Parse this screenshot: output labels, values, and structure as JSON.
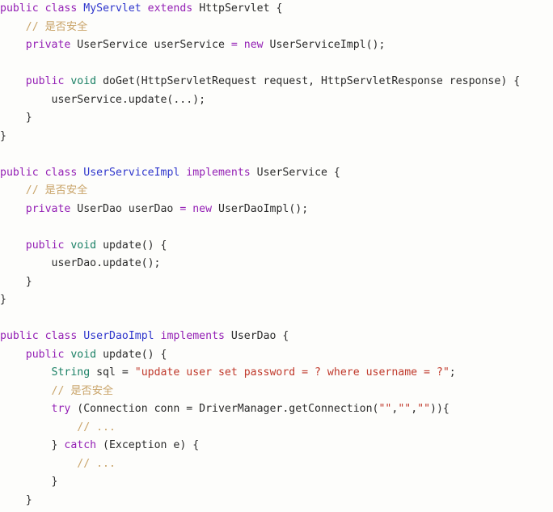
{
  "editor": {
    "language": "java",
    "background_color": "#fdfdfb",
    "default_text_color": "#2b2b2b",
    "theme_colors": {
      "keyword": "#9420b5",
      "type": "#1a8065",
      "class_name": "#2f36cc",
      "string": "#c0392b",
      "comment": "#c9a469",
      "plain": "#2b2b2b"
    }
  },
  "code": {
    "lines": [
      {
        "index": 1,
        "text": "public class MyServlet extends HttpServlet {",
        "tokens": [
          {
            "t": "public",
            "c": "kw"
          },
          {
            "t": " ",
            "c": "plain"
          },
          {
            "t": "class",
            "c": "kw"
          },
          {
            "t": " ",
            "c": "plain"
          },
          {
            "t": "MyServlet",
            "c": "cls"
          },
          {
            "t": " ",
            "c": "plain"
          },
          {
            "t": "extends",
            "c": "kw"
          },
          {
            "t": " HttpServlet {",
            "c": "plain"
          }
        ]
      },
      {
        "index": 2,
        "text": "    // 是否安全",
        "tokens": [
          {
            "t": "    ",
            "c": "plain"
          },
          {
            "t": "// 是否安全",
            "c": "cmt"
          }
        ]
      },
      {
        "index": 3,
        "text": "    private UserService userService = new UserServiceImpl();",
        "tokens": [
          {
            "t": "    ",
            "c": "plain"
          },
          {
            "t": "private",
            "c": "kw"
          },
          {
            "t": " UserService userService ",
            "c": "plain"
          },
          {
            "t": "=",
            "c": "kw"
          },
          {
            "t": " ",
            "c": "plain"
          },
          {
            "t": "new",
            "c": "kw"
          },
          {
            "t": " UserServiceImpl();",
            "c": "plain"
          }
        ]
      },
      {
        "index": 4,
        "text": "",
        "tokens": []
      },
      {
        "index": 5,
        "text": "    public void doGet(HttpServletRequest request, HttpServletResponse response) {",
        "tokens": [
          {
            "t": "    ",
            "c": "plain"
          },
          {
            "t": "public",
            "c": "kw"
          },
          {
            "t": " ",
            "c": "plain"
          },
          {
            "t": "void",
            "c": "type"
          },
          {
            "t": " doGet(HttpServletRequest request, HttpServletResponse response) {",
            "c": "plain"
          }
        ]
      },
      {
        "index": 6,
        "text": "        userService.update(...);",
        "tokens": [
          {
            "t": "        userService.update(...);",
            "c": "plain"
          }
        ]
      },
      {
        "index": 7,
        "text": "    }",
        "tokens": [
          {
            "t": "    }",
            "c": "plain"
          }
        ]
      },
      {
        "index": 8,
        "text": "}",
        "tokens": [
          {
            "t": "}",
            "c": "plain"
          }
        ]
      },
      {
        "index": 9,
        "text": "",
        "tokens": []
      },
      {
        "index": 10,
        "text": "public class UserServiceImpl implements UserService {",
        "tokens": [
          {
            "t": "public",
            "c": "kw"
          },
          {
            "t": " ",
            "c": "plain"
          },
          {
            "t": "class",
            "c": "kw"
          },
          {
            "t": " ",
            "c": "plain"
          },
          {
            "t": "UserServiceImpl",
            "c": "cls"
          },
          {
            "t": " ",
            "c": "plain"
          },
          {
            "t": "implements",
            "c": "kw"
          },
          {
            "t": " UserService {",
            "c": "plain"
          }
        ]
      },
      {
        "index": 11,
        "text": "    // 是否安全",
        "tokens": [
          {
            "t": "    ",
            "c": "plain"
          },
          {
            "t": "// 是否安全",
            "c": "cmt"
          }
        ]
      },
      {
        "index": 12,
        "text": "    private UserDao userDao = new UserDaoImpl();",
        "tokens": [
          {
            "t": "    ",
            "c": "plain"
          },
          {
            "t": "private",
            "c": "kw"
          },
          {
            "t": " UserDao userDao ",
            "c": "plain"
          },
          {
            "t": "=",
            "c": "kw"
          },
          {
            "t": " ",
            "c": "plain"
          },
          {
            "t": "new",
            "c": "kw"
          },
          {
            "t": " UserDaoImpl();",
            "c": "plain"
          }
        ]
      },
      {
        "index": 13,
        "text": "",
        "tokens": []
      },
      {
        "index": 14,
        "text": "    public void update() {",
        "tokens": [
          {
            "t": "    ",
            "c": "plain"
          },
          {
            "t": "public",
            "c": "kw"
          },
          {
            "t": " ",
            "c": "plain"
          },
          {
            "t": "void",
            "c": "type"
          },
          {
            "t": " update() {",
            "c": "plain"
          }
        ]
      },
      {
        "index": 15,
        "text": "        userDao.update();",
        "tokens": [
          {
            "t": "        userDao.update();",
            "c": "plain"
          }
        ]
      },
      {
        "index": 16,
        "text": "    }",
        "tokens": [
          {
            "t": "    }",
            "c": "plain"
          }
        ]
      },
      {
        "index": 17,
        "text": "}",
        "tokens": [
          {
            "t": "}",
            "c": "plain"
          }
        ]
      },
      {
        "index": 18,
        "text": "",
        "tokens": []
      },
      {
        "index": 19,
        "text": "public class UserDaoImpl implements UserDao {",
        "tokens": [
          {
            "t": "public",
            "c": "kw"
          },
          {
            "t": " ",
            "c": "plain"
          },
          {
            "t": "class",
            "c": "kw"
          },
          {
            "t": " ",
            "c": "plain"
          },
          {
            "t": "UserDaoImpl",
            "c": "cls"
          },
          {
            "t": " ",
            "c": "plain"
          },
          {
            "t": "implements",
            "c": "kw"
          },
          {
            "t": " UserDao {",
            "c": "plain"
          }
        ]
      },
      {
        "index": 20,
        "text": "    public void update() {",
        "tokens": [
          {
            "t": "    ",
            "c": "plain"
          },
          {
            "t": "public",
            "c": "kw"
          },
          {
            "t": " ",
            "c": "plain"
          },
          {
            "t": "void",
            "c": "type"
          },
          {
            "t": " update() {",
            "c": "plain"
          }
        ]
      },
      {
        "index": 21,
        "text": "        String sql = \"update user set password = ? where username = ?\";",
        "tokens": [
          {
            "t": "        ",
            "c": "plain"
          },
          {
            "t": "String",
            "c": "type"
          },
          {
            "t": " sql = ",
            "c": "plain"
          },
          {
            "t": "\"update user set password = ? where username = ?\"",
            "c": "str"
          },
          {
            "t": ";",
            "c": "plain"
          }
        ]
      },
      {
        "index": 22,
        "text": "        // 是否安全",
        "tokens": [
          {
            "t": "        ",
            "c": "plain"
          },
          {
            "t": "// 是否安全",
            "c": "cmt"
          }
        ]
      },
      {
        "index": 23,
        "text": "        try (Connection conn = DriverManager.getConnection(\"\",\"\",\"\")){",
        "tokens": [
          {
            "t": "        ",
            "c": "plain"
          },
          {
            "t": "try",
            "c": "kw"
          },
          {
            "t": " (Connection conn = DriverManager.getConnection(",
            "c": "plain"
          },
          {
            "t": "\"\"",
            "c": "str"
          },
          {
            "t": ",",
            "c": "plain"
          },
          {
            "t": "\"\"",
            "c": "str"
          },
          {
            "t": ",",
            "c": "plain"
          },
          {
            "t": "\"\"",
            "c": "str"
          },
          {
            "t": ")){",
            "c": "plain"
          }
        ]
      },
      {
        "index": 24,
        "text": "            // ...",
        "tokens": [
          {
            "t": "            ",
            "c": "plain"
          },
          {
            "t": "// ...",
            "c": "cmt"
          }
        ]
      },
      {
        "index": 25,
        "text": "        } catch (Exception e) {",
        "tokens": [
          {
            "t": "        } ",
            "c": "plain"
          },
          {
            "t": "catch",
            "c": "kw"
          },
          {
            "t": " (Exception e) {",
            "c": "plain"
          }
        ]
      },
      {
        "index": 26,
        "text": "            // ...",
        "tokens": [
          {
            "t": "            ",
            "c": "plain"
          },
          {
            "t": "// ...",
            "c": "cmt"
          }
        ]
      },
      {
        "index": 27,
        "text": "        }",
        "tokens": [
          {
            "t": "        }",
            "c": "plain"
          }
        ]
      },
      {
        "index": 28,
        "text": "    }",
        "tokens": [
          {
            "t": "    }",
            "c": "plain"
          }
        ]
      }
    ]
  }
}
